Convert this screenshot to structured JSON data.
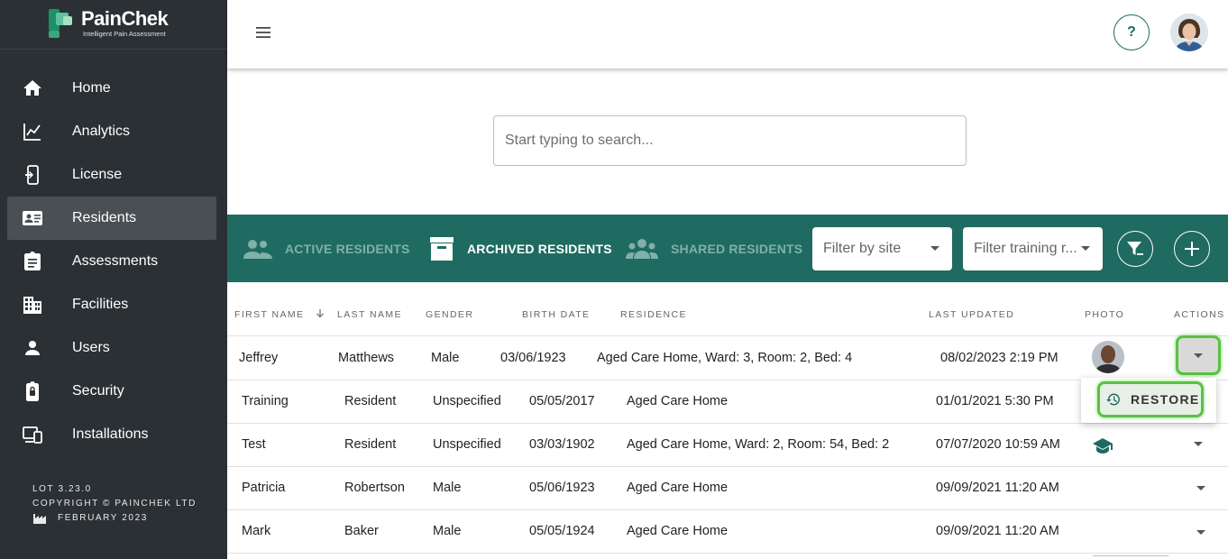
{
  "brand": {
    "name": "PainChek",
    "tagline": "Intelligent Pain Assessment",
    "accent": "#1f6b61",
    "sidebar_bg": "#2b3034",
    "highlight": "#5ac242"
  },
  "sidebar": {
    "items": [
      {
        "label": "Home",
        "icon": "home-icon"
      },
      {
        "label": "Analytics",
        "icon": "analytics-icon"
      },
      {
        "label": "License",
        "icon": "license-icon"
      },
      {
        "label": "Residents",
        "icon": "residents-icon",
        "active": true
      },
      {
        "label": "Assessments",
        "icon": "assessments-icon"
      },
      {
        "label": "Facilities",
        "icon": "facilities-icon"
      },
      {
        "label": "Users",
        "icon": "users-icon"
      },
      {
        "label": "Security",
        "icon": "security-icon"
      },
      {
        "label": "Installations",
        "icon": "installations-icon"
      }
    ],
    "footer": {
      "lot": "LOT 3.23.0",
      "copyright": "COPYRIGHT © PAINCHEK LTD",
      "date": "FEBRUARY 2023"
    }
  },
  "topbar": {
    "help_label": "?"
  },
  "search": {
    "placeholder": "Start typing to search..."
  },
  "tabs": [
    {
      "label": "ACTIVE RESIDENTS",
      "icon": "people-icon",
      "active": false
    },
    {
      "label": "ARCHIVED RESIDENTS",
      "icon": "archive-icon",
      "active": true
    },
    {
      "label": "SHARED RESIDENTS",
      "icon": "group-icon",
      "active": false
    }
  ],
  "filters": {
    "site": "Filter by site",
    "training": "Filter training r..."
  },
  "table": {
    "columns": [
      "FIRST NAME",
      "LAST NAME",
      "GENDER",
      "BIRTH DATE",
      "RESIDENCE",
      "LAST UPDATED",
      "PHOTO",
      "ACTIONS"
    ],
    "rows": [
      {
        "first": "Jeffrey",
        "last": "Matthews",
        "gender": "Male",
        "birth": "03/06/1923",
        "residence": "Aged Care Home, Ward: 3, Room: 2, Bed: 4",
        "updated": "08/02/2023 2:19 PM"
      },
      {
        "first": "Training",
        "last": "Resident",
        "gender": "Unspecified",
        "birth": "05/05/2017",
        "residence": "Aged Care Home",
        "updated": "01/01/2021 5:30 PM"
      },
      {
        "first": "Test",
        "last": "Resident",
        "gender": "Unspecified",
        "birth": "03/03/1902",
        "residence": "Aged Care Home, Ward: 2, Room: 54, Bed: 2",
        "updated": "07/07/2020 10:59 AM"
      },
      {
        "first": "Patricia",
        "last": "Robertson",
        "gender": "Male",
        "birth": "05/06/1923",
        "residence": "Aged Care Home",
        "updated": "09/09/2021 11:20 AM"
      },
      {
        "first": "Mark",
        "last": "Baker",
        "gender": "Male",
        "birth": "05/05/1924",
        "residence": "Aged Care Home",
        "updated": "09/09/2021 11:20 AM"
      }
    ]
  },
  "action_menu": {
    "restore_label": "RESTORE"
  }
}
